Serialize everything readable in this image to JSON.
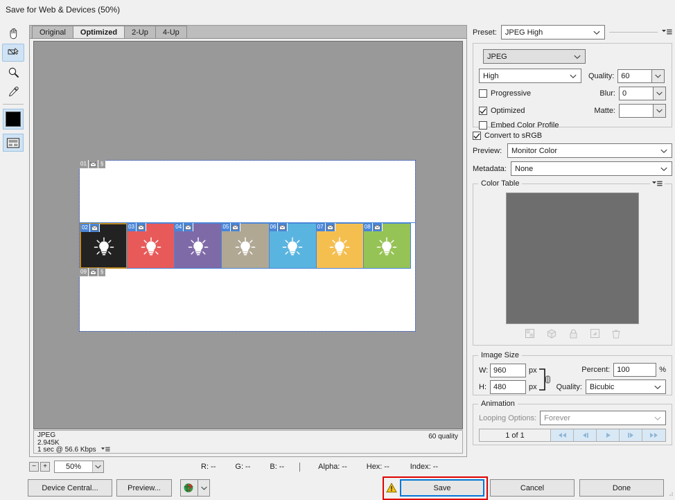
{
  "window": {
    "title": "Save for Web & Devices (50%)"
  },
  "toolbar": {
    "tools": [
      {
        "name": "hand-tool",
        "selected": false
      },
      {
        "name": "slice-select-tool",
        "selected": true
      },
      {
        "name": "zoom-tool",
        "selected": false
      },
      {
        "name": "eyedropper-tool",
        "selected": false
      }
    ],
    "foreground_color": "#000000",
    "toggle_slices_label": "Toggle Slices Visibility"
  },
  "preview": {
    "tabs": [
      {
        "label": "Original",
        "active": false
      },
      {
        "label": "Optimized",
        "active": true
      },
      {
        "label": "2-Up",
        "active": false
      },
      {
        "label": "4-Up",
        "active": false
      }
    ],
    "canvas_background": "#999999",
    "artboard_background": "#ffffff",
    "slices": [
      {
        "id": "01",
        "label": "01",
        "color": "#ffffff",
        "selected": false,
        "linked": true
      },
      {
        "id": "02",
        "label": "02",
        "color": "#222222",
        "selected": true,
        "linked": false
      },
      {
        "id": "03",
        "label": "03",
        "color": "#e85a5a",
        "selected": false,
        "linked": false
      },
      {
        "id": "04",
        "label": "04",
        "color": "#7f6aa8",
        "selected": false,
        "linked": false
      },
      {
        "id": "05",
        "label": "05",
        "color": "#b0a893",
        "selected": false,
        "linked": false
      },
      {
        "id": "06",
        "label": "06",
        "color": "#5ab4e0",
        "selected": false,
        "linked": false
      },
      {
        "id": "07",
        "label": "07",
        "color": "#f5bf50",
        "selected": false,
        "linked": false
      },
      {
        "id": "08",
        "label": "08",
        "color": "#96c356",
        "selected": false,
        "linked": false
      },
      {
        "id": "09",
        "label": "09",
        "color": "#ffffff",
        "selected": false,
        "linked": true
      }
    ],
    "status": {
      "format": "JPEG",
      "filesize": "2.945K",
      "download_time": "1 sec @ 56.6 Kbps",
      "quality_note": "60 quality"
    }
  },
  "readout": {
    "zoom_out": "−",
    "zoom_in": "+",
    "zoom_level": "50%",
    "r": "R: --",
    "g": "G: --",
    "b": "B: --",
    "alpha": "Alpha: --",
    "hex": "Hex: --",
    "index": "Index: --"
  },
  "settings": {
    "preset_label": "Preset:",
    "preset_value": "JPEG High",
    "format_value": "JPEG",
    "compression_quality_value": "High",
    "quality_label": "Quality:",
    "quality_value": "60",
    "progressive_label": "Progressive",
    "progressive_checked": false,
    "blur_label": "Blur:",
    "blur_value": "0",
    "optimized_label": "Optimized",
    "optimized_checked": true,
    "matte_label": "Matte:",
    "matte_value": "",
    "embed_color_profile_label": "Embed Color Profile",
    "embed_color_profile_checked": false,
    "convert_srgb_label": "Convert to sRGB",
    "convert_srgb_checked": true,
    "preview_label": "Preview:",
    "preview_value": "Monitor Color",
    "metadata_label": "Metadata:",
    "metadata_value": "None"
  },
  "color_table": {
    "legend": "Color Table",
    "buttons": [
      "transparency-icon",
      "web-snap-icon",
      "lock-icon",
      "new-swatch-icon",
      "delete-swatch-icon"
    ]
  },
  "image_size": {
    "legend": "Image Size",
    "w_label": "W:",
    "w_value": "960",
    "w_unit": "px",
    "h_label": "H:",
    "h_value": "480",
    "h_unit": "px",
    "percent_label": "Percent:",
    "percent_value": "100",
    "percent_unit": "%",
    "quality_label": "Quality:",
    "quality_value": "Bicubic"
  },
  "animation": {
    "legend": "Animation",
    "looping_label": "Looping Options:",
    "looping_value": "Forever",
    "frame_counter": "1 of 1",
    "controls": [
      "first-frame",
      "previous-frame",
      "play",
      "next-frame",
      "last-frame"
    ]
  },
  "buttons": {
    "device_central": "Device Central...",
    "preview": "Preview...",
    "browser_icon": "browser-globe-icon",
    "warning_icon": "warning-triangle-icon",
    "save": "Save",
    "cancel": "Cancel",
    "done": "Done"
  },
  "colors": {
    "accent_focus": "#0078d7",
    "slice_border": "#4a86d8",
    "slice_selected_border": "#c08a20",
    "annotation": "#e00000",
    "panel_bg": "#f0f0f0"
  }
}
